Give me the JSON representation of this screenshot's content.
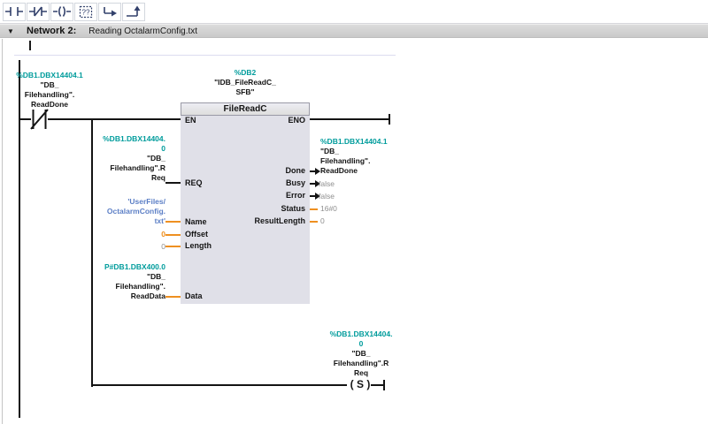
{
  "colors": {
    "address_teal": "#009c9c",
    "string_blue": "#5c7fc6",
    "nonbool_orange": "#ee9021",
    "value_gray": "#8f8f8f"
  },
  "toolbar": {
    "buttons": [
      {
        "name": "insert-open-contact"
      },
      {
        "name": "insert-closed-contact"
      },
      {
        "name": "insert-coil"
      },
      {
        "name": "insert-empty-box",
        "glyph": "??"
      },
      {
        "name": "open-branch"
      },
      {
        "name": "close-branch"
      }
    ]
  },
  "network_header": {
    "collapse_icon": "▼",
    "label": "Network 2:",
    "title": "Reading OctalarmConfig.txt"
  },
  "contact": {
    "lines": [
      "%DB1.DBX14404.1",
      "\"DB_",
      "Filehandling\".",
      "ReadDone"
    ]
  },
  "block": {
    "db": "%DB2",
    "instance": [
      "\"IDB_FileReadC_",
      "SFB\""
    ],
    "title": "FileReadC",
    "en_label": "EN",
    "eno_label": "ENO",
    "ports": {
      "req": "REQ",
      "name": "Name",
      "offset": "Offset",
      "length": "Length",
      "data": "Data",
      "done": "Done",
      "busy": "Busy",
      "error": "Error",
      "status": "Status",
      "result_length": "ResultLength"
    }
  },
  "operands": {
    "req": [
      "%DB1.DBX14404.",
      "0",
      "\"DB_",
      "Filehandling\".R",
      "Req"
    ],
    "name": [
      "'UserFiles/",
      "OctalarmConfig.",
      "txt'"
    ],
    "offset": "0",
    "length": "0",
    "data": [
      "P#DB1.DBX400.0",
      "\"DB_",
      "Filehandling\".",
      "ReadData"
    ],
    "done": [
      "%DB1.DBX14404.1",
      "\"DB_",
      "Filehandling\".",
      "ReadDone"
    ],
    "busy": "false",
    "error": "false",
    "status": "16#0",
    "result_length": "0"
  },
  "coil": {
    "symbol": "( S )",
    "lines": [
      "%DB1.DBX14404.",
      "0",
      "\"DB_",
      "Filehandling\".R",
      "Req"
    ]
  }
}
